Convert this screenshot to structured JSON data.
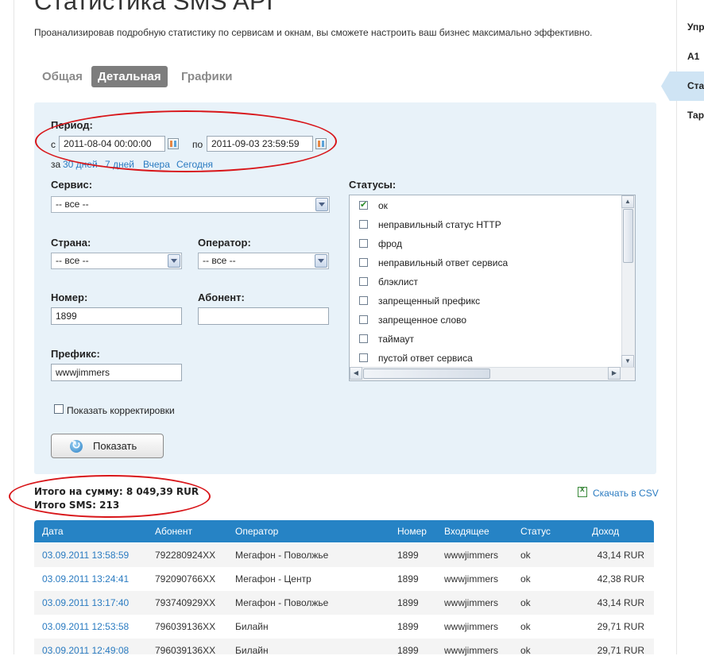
{
  "page": {
    "title": "Статистика SMS API",
    "subtitle": "Проанализировав подробную статистику по сервисам и окнам, вы сможете настроить ваш бизнес максимально эффективно."
  },
  "tabs": [
    {
      "label": "Общая",
      "active": false
    },
    {
      "label": "Детальная",
      "active": true
    },
    {
      "label": "Графики",
      "active": false
    }
  ],
  "filters": {
    "period_label": "Период:",
    "from_prefix": "с",
    "from_value": "2011-08-04 00:00:00",
    "to_prefix": "по",
    "to_value": "2011-09-03 23:59:59",
    "quick_prefix": "за",
    "quick_links": [
      "30 дней",
      "7 дней",
      "Вчера",
      "Сегодня"
    ],
    "service_label": "Сервис:",
    "service_value": "-- все --",
    "country_label": "Страна:",
    "country_value": "-- все --",
    "operator_label": "Оператор:",
    "operator_value": "-- все --",
    "number_label": "Номер:",
    "number_value": "1899",
    "subscriber_label": "Абонент:",
    "subscriber_value": "",
    "prefix_label": "Префикс:",
    "prefix_value": "wwwjimmers",
    "show_corrections_label": "Показать корректировки",
    "show_corrections_checked": false,
    "statuses_label": "Статусы:",
    "statuses": [
      {
        "label": "ок",
        "checked": true
      },
      {
        "label": "неправильный статус HTTP",
        "checked": false
      },
      {
        "label": "фрод",
        "checked": false
      },
      {
        "label": "неправильный ответ сервиса",
        "checked": false
      },
      {
        "label": "блэклист",
        "checked": false
      },
      {
        "label": "запрещенный префикс",
        "checked": false
      },
      {
        "label": "запрещенное слово",
        "checked": false
      },
      {
        "label": "таймаут",
        "checked": false
      },
      {
        "label": "пустой ответ сервиса",
        "checked": false
      }
    ],
    "show_button": "Показать"
  },
  "totals": {
    "sum_line": "Итого на сумму: 8 049,39 RUR",
    "sms_line": "Итого SMS: 213"
  },
  "csv_link": "Скачать в CSV",
  "table": {
    "headers": [
      "Дата",
      "Абонент",
      "Оператор",
      "Номер",
      "Входящее",
      "Статус",
      "Доход"
    ],
    "rows": [
      [
        "03.09.2011 13:58:59",
        "792280924XX",
        "Мегафон - Поволжье",
        "1899",
        "wwwjimmers",
        "ok",
        "43,14 RUR"
      ],
      [
        "03.09.2011 13:24:41",
        "792090766XX",
        "Мегафон - Центр",
        "1899",
        "wwwjimmers",
        "ok",
        "42,38 RUR"
      ],
      [
        "03.09.2011 13:17:40",
        "793740929XX",
        "Мегафон - Поволжье",
        "1899",
        "wwwjimmers",
        "ok",
        "43,14 RUR"
      ],
      [
        "03.09.2011 12:53:58",
        "796039136XX",
        "Билайн",
        "1899",
        "wwwjimmers",
        "ok",
        "29,71 RUR"
      ],
      [
        "03.09.2011 12:49:08",
        "796039136XX",
        "Билайн",
        "1899",
        "wwwjimmers",
        "ok",
        "29,71 RUR"
      ]
    ]
  },
  "right_menu": [
    "Упр",
    "А1",
    "Ста",
    "Тар"
  ],
  "colors": {
    "accent": "#2683c5",
    "filter_bg": "#e8f2f9",
    "link": "#2a7bc1",
    "annotation": "#d8161a"
  }
}
